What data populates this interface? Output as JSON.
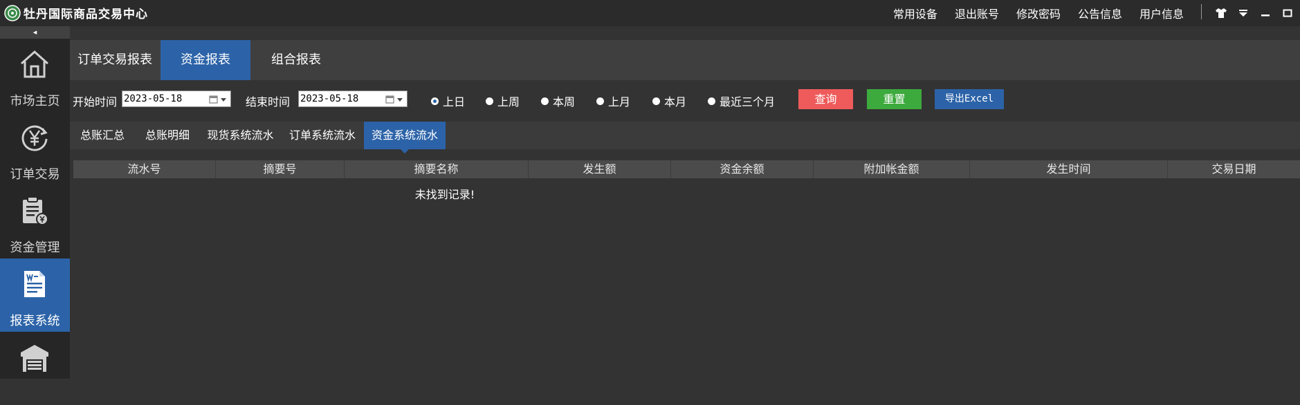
{
  "header": {
    "title": "牡丹国际商品交易中心",
    "menu": [
      "常用设备",
      "退出账号",
      "修改密码",
      "公告信息",
      "用户信息"
    ],
    "icons": [
      "shirt-icon",
      "dropdown-icon",
      "minimize-icon",
      "maximize-icon"
    ]
  },
  "sidebar": {
    "collapse": "◂",
    "items": [
      {
        "label": "市场主页",
        "icon": "home-icon"
      },
      {
        "label": "订单交易",
        "icon": "yen-exchange-icon"
      },
      {
        "label": "资金管理",
        "icon": "fund-clipboard-icon"
      },
      {
        "label": "报表系统",
        "icon": "report-document-icon"
      },
      {
        "label": "",
        "icon": "warehouse-icon"
      }
    ]
  },
  "tabs": [
    "订单交易报表",
    "资金报表",
    "组合报表"
  ],
  "filter": {
    "start_label": "开始时间",
    "start_value": "2023-05-18",
    "end_label": "结束时间",
    "end_value": "2023-05-18",
    "periods": [
      "上日",
      "上周",
      "本周",
      "上月",
      "本月",
      "最近三个月"
    ],
    "selected_period": "上日",
    "query": "查询",
    "reset": "重置",
    "export": "导出Excel",
    "colors": {
      "query": "#ef5b5b",
      "reset": "#3daa3d",
      "export": "#2c63a8"
    }
  },
  "subtabs": [
    "总账汇总",
    "总账明细",
    "现货系统流水",
    "订单系统流水",
    "资金系统流水"
  ],
  "table": {
    "columns": [
      "流水号",
      "摘要号",
      "摘要名称",
      "发生额",
      "资金余额",
      "附加帐金额",
      "发生时间",
      "交易日期"
    ],
    "empty": "未找到记录!"
  }
}
